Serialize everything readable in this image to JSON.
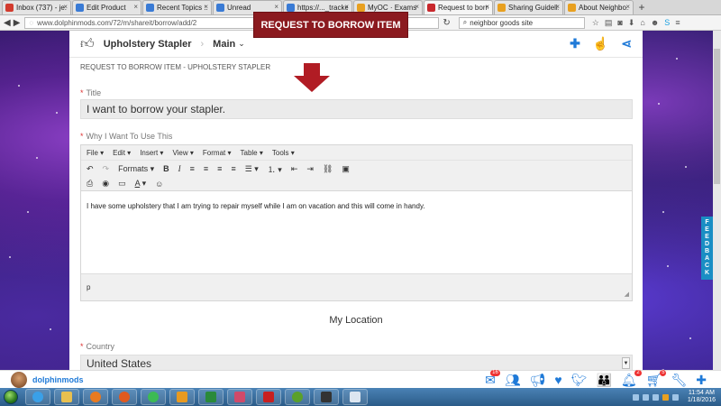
{
  "browser": {
    "tabs": [
      {
        "label": "Inbox (737) - je...",
        "color": "#d23b2e"
      },
      {
        "label": "Edit Product",
        "color": "#3a7bd5"
      },
      {
        "label": "Recent Topics :...",
        "color": "#3a7bd5"
      },
      {
        "label": "Unread",
        "color": "#3a7bd5"
      },
      {
        "label": "https://..._tracker",
        "color": "#3a7bd5"
      },
      {
        "label": "MyOC · Exams",
        "color": "#e8a020"
      },
      {
        "label": "Request to borro...",
        "color": "#c8282d",
        "active": true
      },
      {
        "label": "Sharing Guideli...",
        "color": "#e8a020"
      },
      {
        "label": "About Neighbo...",
        "color": "#e8a020"
      }
    ],
    "url": "www.dolphinmods.com/72/m/shareit/borrow/add/2",
    "search_value": "neighbor goods site"
  },
  "overlay": {
    "banner": "REQUEST TO BORROW ITEM"
  },
  "header": {
    "breadcrumb_item": "Upholstery Stapler",
    "breadcrumb_menu": "Main"
  },
  "form": {
    "subtitle": "REQUEST TO BORROW ITEM - UPHOLSTERY STAPLER",
    "title_label": "Title",
    "title_value": "I want to borrow your stapler.",
    "why_label": "Why I Want To Use This",
    "menu": [
      "File",
      "Edit",
      "Insert",
      "View",
      "Format",
      "Table",
      "Tools"
    ],
    "formats_label": "Formats",
    "body_text": "I have some upholstery that I am trying to repair myself while I am on vacation and this will come in handy.",
    "status_path": "p",
    "location_title": "My Location",
    "country_label": "Country",
    "country_value": "United States"
  },
  "feedback_label": "FEEDBACK",
  "bottom": {
    "username": "dolphinmods",
    "badges": {
      "mail": "16",
      "alerts": "2",
      "cart": "5"
    }
  },
  "taskbar": {
    "time": "11:54 AM",
    "date": "1/18/2016"
  }
}
